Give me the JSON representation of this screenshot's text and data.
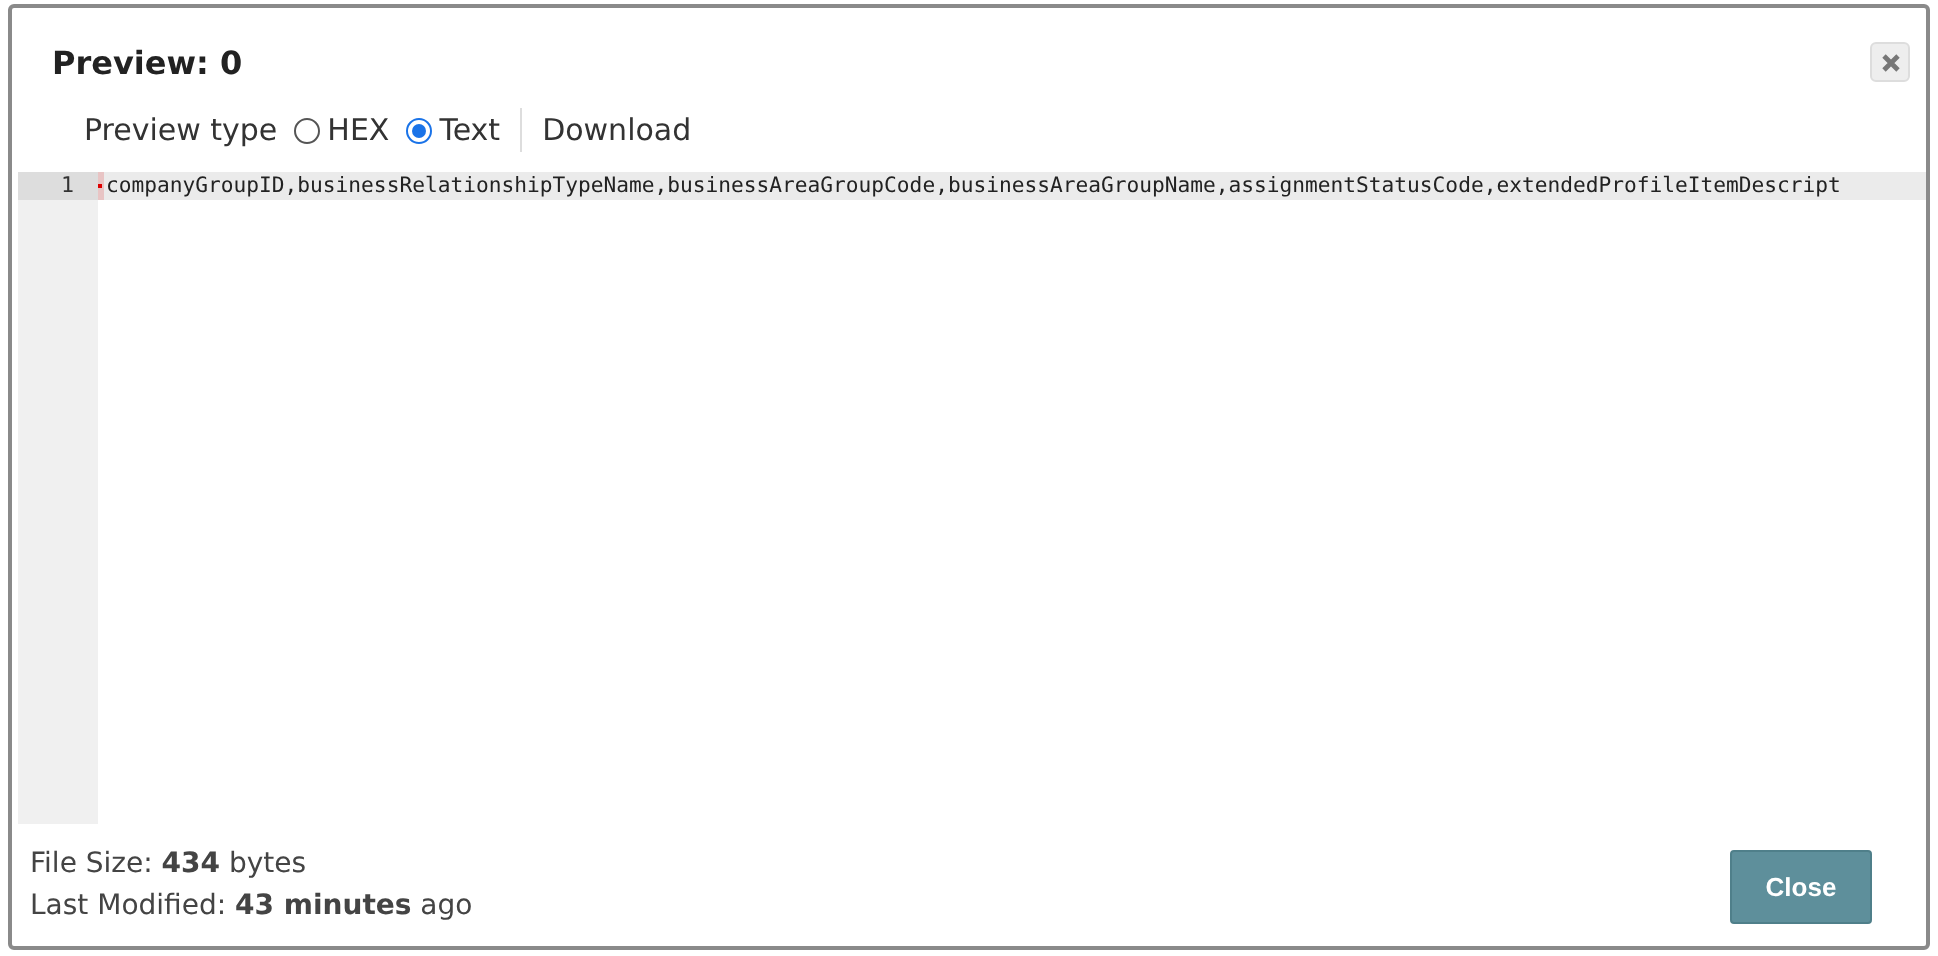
{
  "dialog": {
    "title": "Preview: 0"
  },
  "preview_type": {
    "label": "Preview type",
    "options": [
      {
        "label": "HEX",
        "selected": false
      },
      {
        "label": "Text",
        "selected": true
      }
    ]
  },
  "download": {
    "label": "Download"
  },
  "editor": {
    "lines": [
      {
        "number": "1",
        "text": "companyGroupID,businessRelationshipTypeName,businessAreaGroupCode,businessAreaGroupName,assignmentStatusCode,extendedProfileItemDescript"
      }
    ]
  },
  "footer": {
    "file_size": "File Size: **434** bytes",
    "last_modified": "Last Modified: **43 minutes** ago"
  },
  "close_button": {
    "label": "Close"
  }
}
